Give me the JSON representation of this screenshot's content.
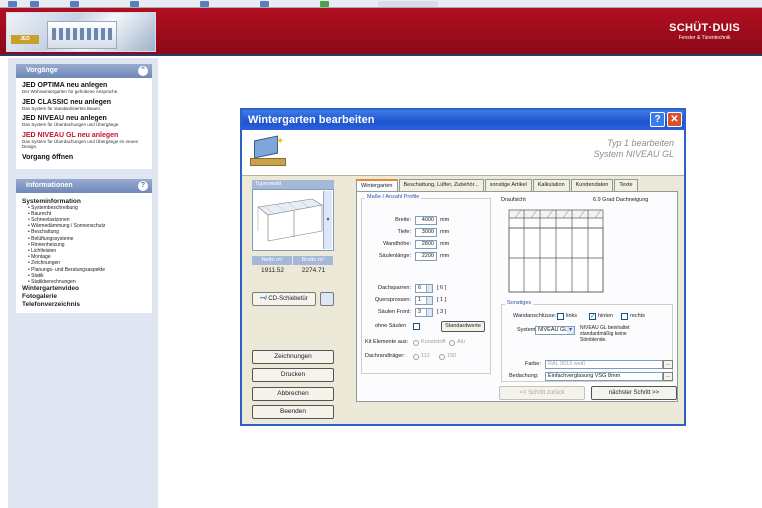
{
  "header": {
    "photo_logo": "JED",
    "brand_name": "SCHÜT·DUIS",
    "brand_tagline": "Fenster & Türentechnik"
  },
  "sidebar": {
    "vorgaenge": {
      "title": "Vorgänge",
      "items": [
        {
          "title": "JED OPTIMA neu anlegen",
          "desc": "Der Wohnwintergarten für gehobene Ansprüche."
        },
        {
          "title": "JED CLASSIC neu anlegen",
          "desc": "Das System für standardisiertes Bauen."
        },
        {
          "title": "JED NIVEAU neu anlegen",
          "desc": "Das System für Überdachungen und Übergänge."
        },
        {
          "title": "JED NIVEAU GL neu anlegen",
          "desc": "Das System für Überdachungen und Übergänge im neuen Design."
        }
      ],
      "open_label": "Vorgang öffnen"
    },
    "informationen": {
      "title": "Informationen",
      "section_title": "Systeminformation",
      "subitems": [
        "Systembeschreibung",
        "Baurecht",
        "Schneelastzonen",
        "Wärmedämmung / Sonnenschutz",
        "Beschattung",
        "Belüftungssysteme",
        "Rinnenheizung",
        "Lichtleisten",
        "Montage",
        "Zeichnungen",
        "Planungs- und Beratungsaspekte",
        "Statik",
        "Statikberechnungen"
      ],
      "links": [
        "Wintergartenvideo",
        "Fotogalerie",
        "Telefonverzeichnis"
      ]
    }
  },
  "dialog": {
    "title": "Wintergarten bearbeiten",
    "subtitle_line1": "Typ 1 bearbeiten",
    "subtitle_line2": "System NIVEAU GL",
    "left": {
      "preview_label": "Typenwahl",
      "col1_label": "Netto m²",
      "col2_label": "Brutto m²",
      "col1_value": "1911.52",
      "col2_value": "2274.71",
      "cd_button": "CD-Schiebetür",
      "buttons": [
        "Zeichnungen",
        "Drucken",
        "Abbrechen",
        "Beenden"
      ]
    },
    "tabs": [
      "Wintergarten",
      "Beschattung, Lüfter, Zubehör...",
      "sonstige Artikel",
      "Kalkulation",
      "Kundendaten",
      "Texte"
    ],
    "active_tab": 0,
    "measures": {
      "title": "Maße / Anzahl Profile",
      "fields": [
        {
          "label": "Breite:",
          "value": "4000",
          "unit": "mm"
        },
        {
          "label": "Tiefe:",
          "value": "3000",
          "unit": "mm"
        },
        {
          "label": "Wandhöhe:",
          "value": "2800",
          "unit": "mm"
        },
        {
          "label": "Säulenlänge:",
          "value": "2200",
          "unit": "mm"
        }
      ],
      "counters": [
        {
          "label": "Dachsparren:",
          "value": "6",
          "max": "[ 6 ]"
        },
        {
          "label": "Quersprossen:",
          "value": "1",
          "max": "[ 1 ]"
        },
        {
          "label": "Säulen Front:",
          "value": "3",
          "max": "[ 3 ]"
        }
      ],
      "ohne_saeulen_label": "ohne Säulen",
      "standard_button": "Standardwerte",
      "kit_label": "Kit Elemente aus:",
      "kit_options": [
        "Kunststoff",
        "Alu"
      ],
      "dachrand_label": "Dachrandträger:",
      "dachrand_options": [
        "112",
        "150"
      ]
    },
    "view": {
      "title": "Draufsicht",
      "roof_pitch": "6.9 Grad Dachneigung"
    },
    "sonstiges": {
      "title": "Sonstiges",
      "wall_label": "Wandanschlüsse:",
      "wall_options": [
        {
          "label": "links",
          "checked": false
        },
        {
          "label": "hinten",
          "checked": true
        },
        {
          "label": "rechts",
          "checked": false
        }
      ],
      "system_label": "System:",
      "system_value": "NIVEAU GL",
      "system_note": "NIVEAU GL beinhaltet standardmäßig keine Stirnblende.",
      "farbe_label": "Farbe:",
      "farbe_value": "RAL 9016 weiß",
      "bedachung_label": "Bedachung:",
      "bedachung_value": "Einfachverglasung VSG 8mm"
    },
    "nav": {
      "back": "<< Schritt zurück",
      "next": "nächster Schritt >>"
    }
  }
}
